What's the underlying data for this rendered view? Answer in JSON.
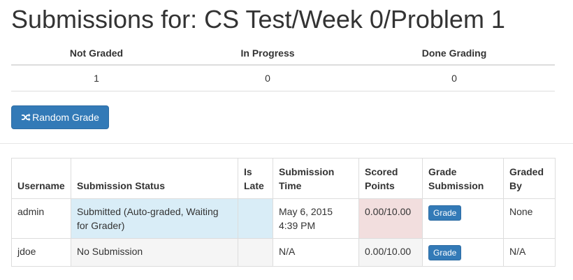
{
  "page": {
    "title": "Submissions for: CS Test/Week 0/Problem 1"
  },
  "summary": {
    "headers": [
      "Not Graded",
      "In Progress",
      "Done Grading"
    ],
    "values": [
      "1",
      "0",
      "0"
    ]
  },
  "random_grade": {
    "label": "Random Grade",
    "icon": "random-icon"
  },
  "submissions": {
    "headers": {
      "username": "Username",
      "status": "Submission Status",
      "is_late": "Is Late",
      "time": "Submission Time",
      "points": "Scored Points",
      "grade": "Grade Submission",
      "graded_by": "Graded By"
    },
    "rows": [
      {
        "username": "admin",
        "status": "Submitted (Auto-graded, Waiting for Grader)",
        "is_late": "",
        "time": "May 6, 2015 4:39 PM",
        "points": "0.00/10.00",
        "grade_label": "Grade",
        "graded_by": "None"
      },
      {
        "username": "jdoe",
        "status": "No Submission",
        "is_late": "",
        "time": "N/A",
        "points": "0.00/10.00",
        "grade_label": "Grade",
        "graded_by": "N/A"
      }
    ]
  },
  "colors": {
    "primary": "#337ab7",
    "info_row": "#d9edf7",
    "danger_cell": "#f2dede",
    "muted_row": "#f5f5f5"
  }
}
